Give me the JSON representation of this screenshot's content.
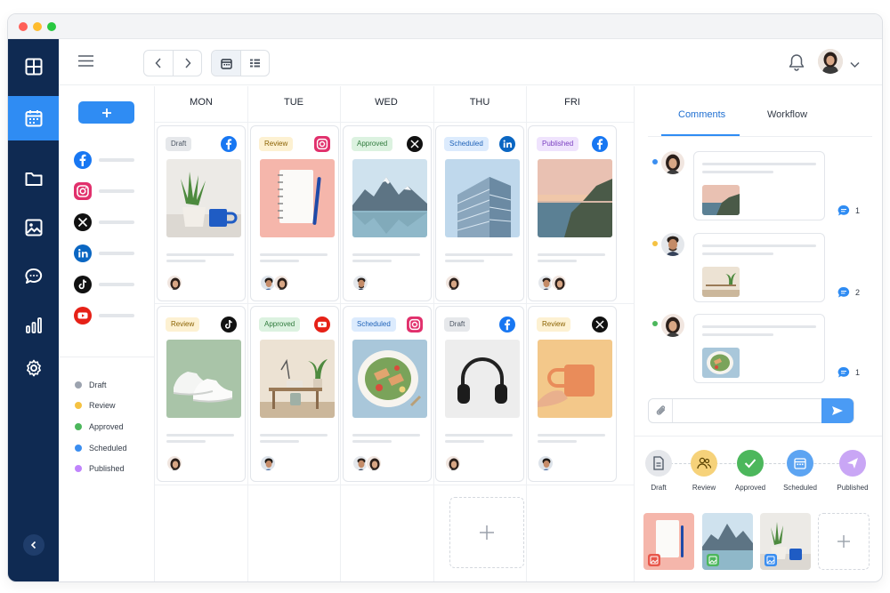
{
  "window": {
    "controls": [
      "close",
      "minimize",
      "maximize"
    ]
  },
  "nav": {
    "items": [
      "dashboard-icon",
      "calendar-icon",
      "folder-icon",
      "image-icon",
      "chat-icon",
      "analytics-icon",
      "settings-icon"
    ],
    "active": "calendar-icon",
    "active_color": "#2f8cf3",
    "background": "#0f2a52"
  },
  "topbar": {
    "nav_buttons": [
      "chevron-left-icon",
      "chevron-right-icon"
    ],
    "view_buttons": [
      "calendar-view-icon",
      "list-view-icon"
    ],
    "active_view": "calendar-view-icon"
  },
  "accounts": {
    "networks": [
      "facebook",
      "instagram",
      "x",
      "linkedin",
      "tiktok",
      "youtube"
    ]
  },
  "legend": [
    {
      "label": "Draft",
      "color": "#9ca3af"
    },
    {
      "label": "Review",
      "color": "#f5c242"
    },
    {
      "label": "Approved",
      "color": "#4cb75c"
    },
    {
      "label": "Scheduled",
      "color": "#3b8ef0"
    },
    {
      "label": "Published",
      "color": "#c084fc"
    }
  ],
  "calendar": {
    "days": [
      "MON",
      "TUE",
      "WED",
      "THU",
      "FRI"
    ],
    "posts": [
      {
        "status": "Draft",
        "network": "facebook",
        "image": "plant-and-mug"
      },
      {
        "status": "Review",
        "network": "instagram",
        "image": "notebook-and-pen"
      },
      {
        "status": "Approved",
        "network": "x",
        "image": "mountain-lake"
      },
      {
        "status": "Scheduled",
        "network": "linkedin",
        "image": "glass-building"
      },
      {
        "status": "Published",
        "network": "facebook",
        "image": "coastal-sunset"
      },
      {
        "status": "Review",
        "network": "tiktok",
        "image": "white-sneakers"
      },
      {
        "status": "Approved",
        "network": "youtube",
        "image": "desk-workspace"
      },
      {
        "status": "Scheduled",
        "network": "instagram",
        "image": "salad-bowl"
      },
      {
        "status": "Draft",
        "network": "facebook",
        "image": "headphones"
      },
      {
        "status": "Review",
        "network": "x",
        "image": "orange-mug"
      }
    ]
  },
  "panel": {
    "tabs": [
      "Comments",
      "Workflow"
    ],
    "active_tab": "Comments",
    "comments": [
      {
        "count": "1",
        "dot_color": "#3b8ef0"
      },
      {
        "count": "2",
        "dot_color": "#f5c242"
      },
      {
        "count": "1",
        "dot_color": "#4cb75c"
      }
    ],
    "workflow": [
      {
        "label": "Draft",
        "color": "#e5e7eb"
      },
      {
        "label": "Review",
        "color": "#f6d27a"
      },
      {
        "label": "Approved",
        "color": "#4cb75c"
      },
      {
        "label": "Scheduled",
        "color": "#5ca4f2"
      },
      {
        "label": "Published",
        "color": "#c9a6f5"
      }
    ]
  }
}
